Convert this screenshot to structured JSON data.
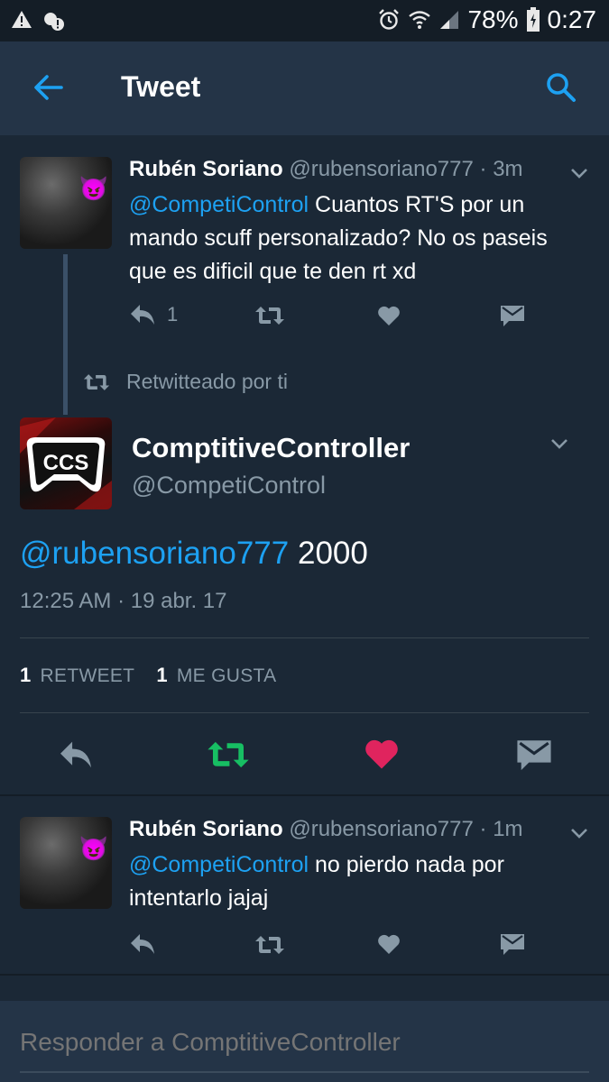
{
  "status_bar": {
    "battery": "78%",
    "time": "0:27"
  },
  "header": {
    "title": "Tweet"
  },
  "reply_tweet_1": {
    "name": "Rubén Soriano",
    "handle": "@rubensoriano777",
    "time": "· 3m",
    "mention": "@CompetiControl",
    "text": " Cuantos RT'S por un mando scuff personalizado? No os paseis que es dificil que te den rt xd",
    "reply_count": "1"
  },
  "retweet_notice": {
    "label": "Retwitteado por ti"
  },
  "main_tweet": {
    "logo_text": "CCS",
    "name": "ComptitiveController",
    "handle": "@CompetiControl",
    "mention": "@rubensoriano777",
    "text": " 2000",
    "timestamp": "12:25 AM · 19 abr. 17",
    "retweet_count": "1",
    "retweet_label": "RETWEET",
    "like_count": "1",
    "like_label": "ME GUSTA"
  },
  "reply_tweet_2": {
    "name": "Rubén Soriano",
    "handle": "@rubensoriano777",
    "time": "· 1m",
    "mention": "@CompetiControl",
    "text": " no pierdo nada por intentarlo jajaj"
  },
  "reply_box": {
    "placeholder": "Responder a ComptitiveController"
  },
  "colors": {
    "background": "#1b2836",
    "header": "#243447",
    "accent_blue": "#1da1f2",
    "retweet_green": "#17bf63",
    "like_red": "#e0245e",
    "muted": "#8899a6"
  },
  "icons": [
    "warning-icon",
    "alert-icon",
    "alarm-icon",
    "wifi-icon",
    "signal-icon",
    "battery-icon",
    "back-arrow-icon",
    "search-icon",
    "chevron-down-icon",
    "reply-icon",
    "retweet-icon",
    "heart-icon",
    "dm-icon",
    "devil-emoji-icon"
  ]
}
